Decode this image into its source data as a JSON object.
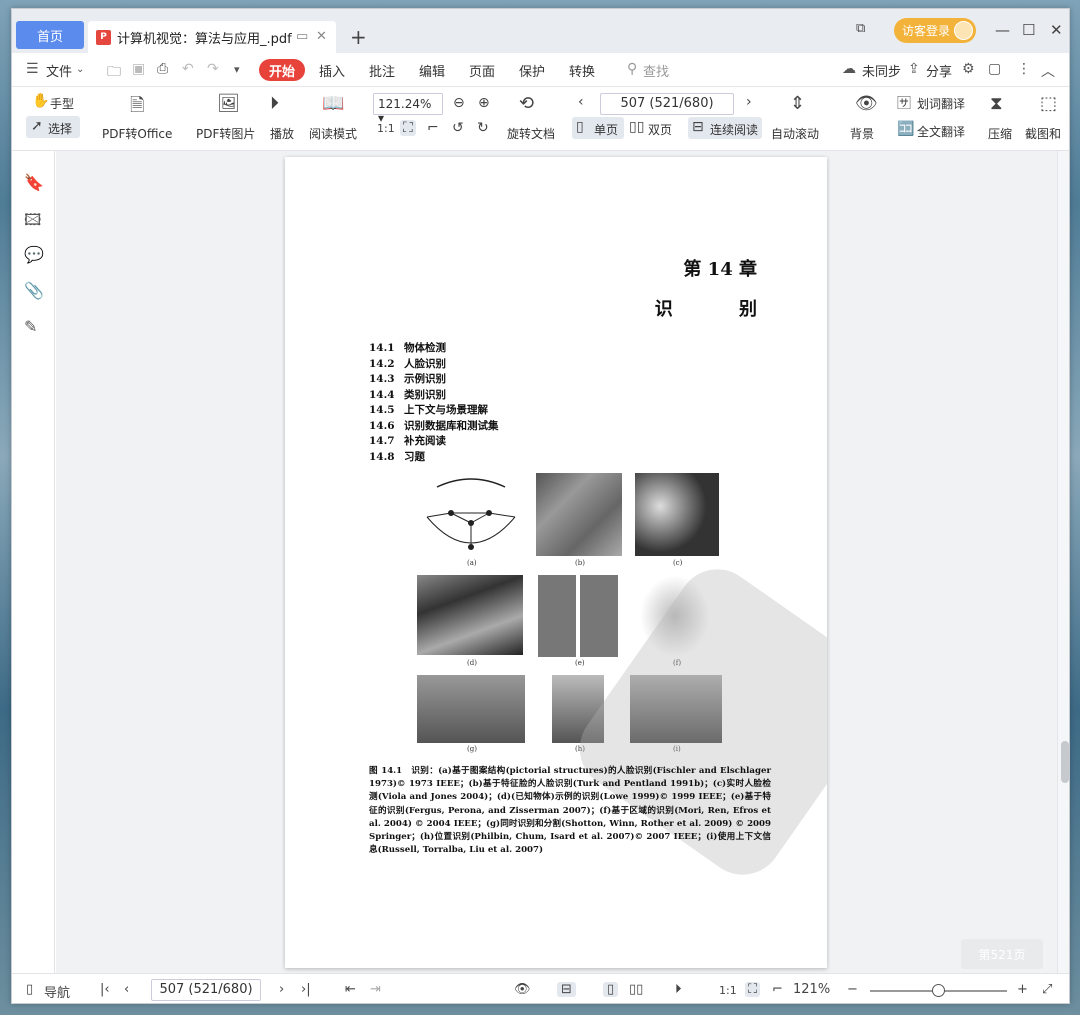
{
  "tabs": {
    "home": "首页",
    "document": "计算机视觉：算法与应用_.pdf",
    "new_tab": "+",
    "guest_login": "访客登录"
  },
  "menu": {
    "file": "文件",
    "start": "开始",
    "items": [
      "插入",
      "批注",
      "编辑",
      "页面",
      "保护",
      "转换"
    ],
    "search": "查找",
    "sync": "未同步",
    "share": "分享"
  },
  "toolbar": {
    "hand": "手型",
    "select": "选择",
    "pdf_to_office": "PDF转Office",
    "pdf_to_image": "PDF转图片",
    "play": "播放",
    "read_mode": "阅读模式",
    "zoom": "121.24%",
    "rotate": "旋转文档",
    "page_indicator": "507 (521/680)",
    "single_page": "单页",
    "double_page": "双页",
    "continuous": "连续阅读",
    "auto_scroll": "自动滚动",
    "background": "背景",
    "word_translate": "划词翻译",
    "full_translate": "全文翻译",
    "compress": "压缩",
    "screenshot": "截图和"
  },
  "page": {
    "chapter": "第 14 章",
    "chapter_title": "识 别",
    "toc": [
      {
        "num": "14.1",
        "title": "物体检测"
      },
      {
        "num": "14.2",
        "title": "人脸识别"
      },
      {
        "num": "14.3",
        "title": "示例识别"
      },
      {
        "num": "14.4",
        "title": "类别识别"
      },
      {
        "num": "14.5",
        "title": "上下文与场景理解"
      },
      {
        "num": "14.6",
        "title": "识别数据库和测试集"
      },
      {
        "num": "14.7",
        "title": "补充阅读"
      },
      {
        "num": "14.8",
        "title": "习题"
      }
    ],
    "figure_labels": [
      "(a)",
      "(b)",
      "(c)",
      "(d)",
      "(e)",
      "(f)",
      "(g)",
      "(h)",
      "(i)"
    ],
    "caption": "图 14.1　识别：(a)基于图案结构(pictorial structures)的人脸识别(Fischler and Elschlager 1973)© 1973 IEEE；(b)基于特征脸的人脸识别(Turk and Pentland 1991b)；(c)实时人脸检测(Viola and Jones 2004)；(d)(已知物体)示例的识别(Lowe 1999)© 1999 IEEE；(e)基于特征的识别(Fergus, Perona, and Zisserman 2007)；(f)基于区域的识别(Mori, Ren, Efros et al. 2004) © 2004 IEEE；(g)同时识别和分割(Shotton, Winn, Rother et al. 2009) © 2009 Springer；(h)位置识别(Philbin, Chum, Isard et al. 2007)© 2007 IEEE；(i)使用上下文信息(Russell, Torralba, Liu et al. 2007)"
  },
  "page_badge": "第521页",
  "status": {
    "nav": "导航",
    "page_indicator": "507 (521/680)",
    "zoom": "121%"
  }
}
